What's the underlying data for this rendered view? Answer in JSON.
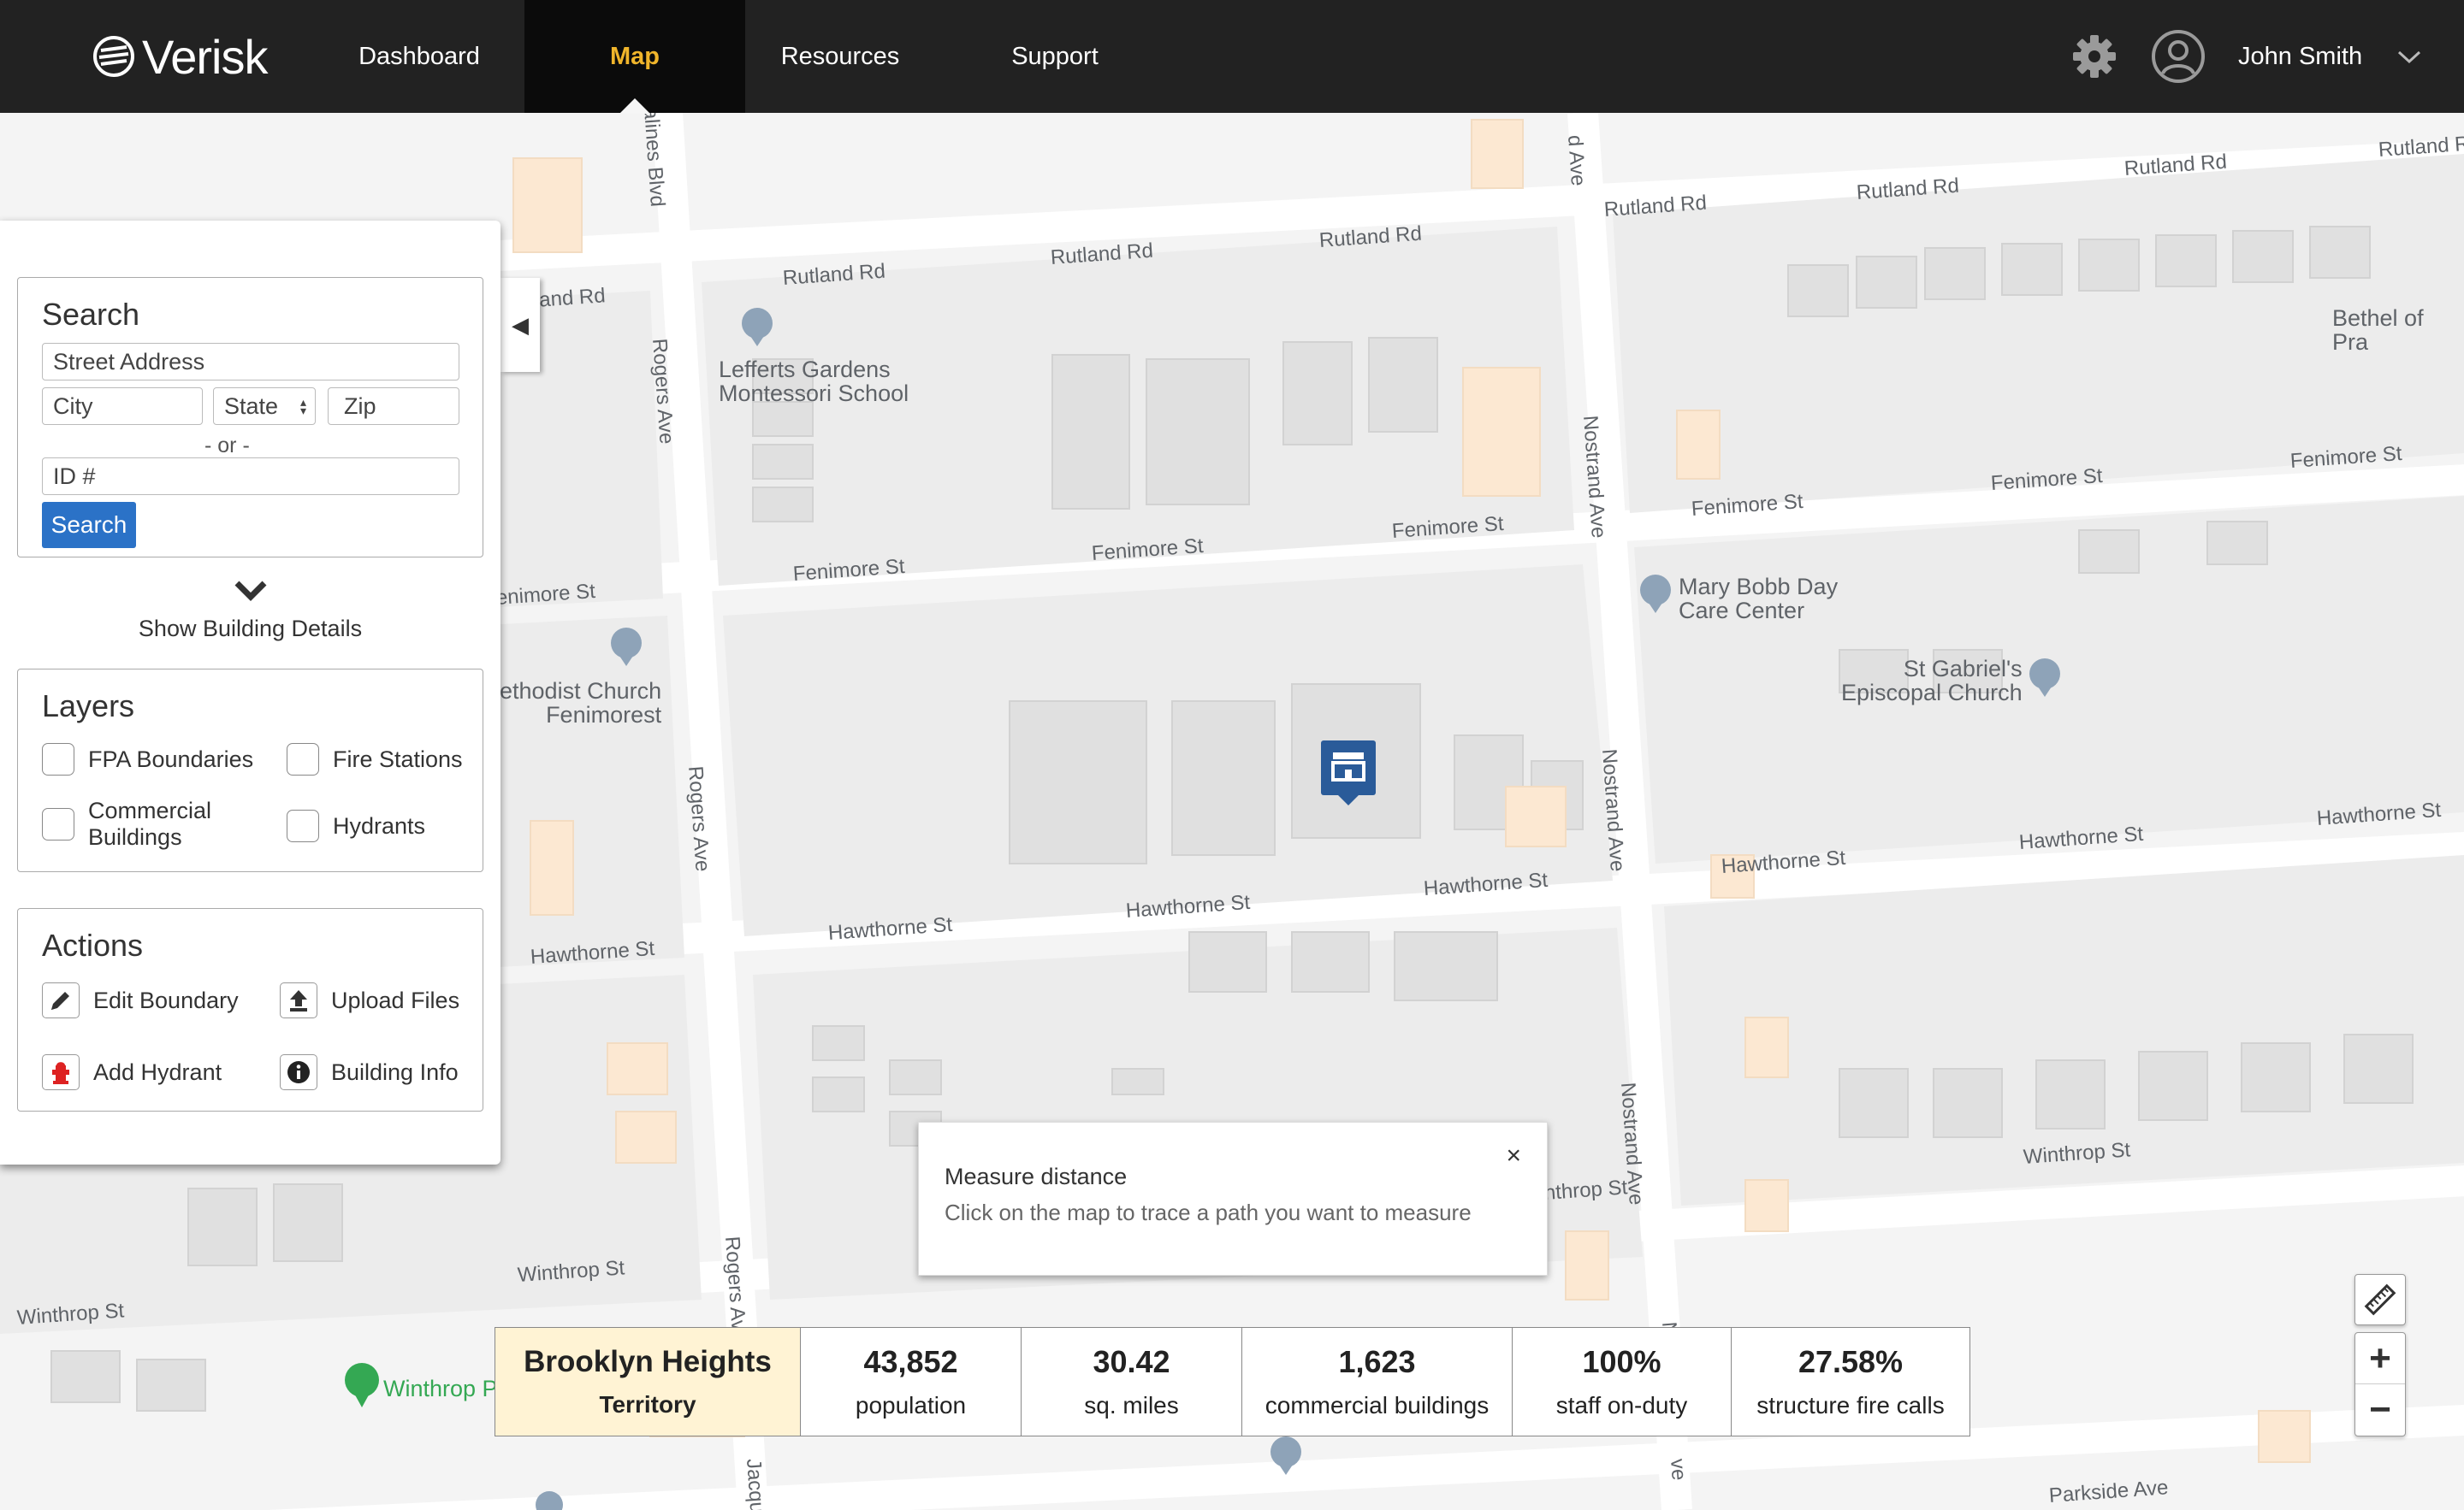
{
  "brand": {
    "name": "Verisk"
  },
  "nav": {
    "items": [
      {
        "label": "Dashboard",
        "active": false
      },
      {
        "label": "Map",
        "active": true
      },
      {
        "label": "Resources",
        "active": false
      },
      {
        "label": "Support",
        "active": false
      }
    ],
    "user_name": "John Smith",
    "settings_icon": "gear-icon",
    "avatar_icon": "user-circle-icon",
    "dropdown_icon": "chevron-down-icon"
  },
  "colors": {
    "nav_bg": "#222222",
    "nav_active": "#f0b52b",
    "primary": "#2b72c7",
    "territory_highlight": "#fff3d4"
  },
  "search": {
    "title": "Search",
    "street_placeholder": "Street Address",
    "city_placeholder": "City",
    "state_placeholder": "State",
    "zip_placeholder": "Zip",
    "or_text": "- or -",
    "id_placeholder": "ID #",
    "button_label": "Search"
  },
  "building_details": {
    "label": "Show Building Details"
  },
  "layers": {
    "title": "Layers",
    "items": [
      {
        "label": "FPA Boundaries",
        "checked": false
      },
      {
        "label": "Fire Stations",
        "checked": false
      },
      {
        "label": "Commercial Buildings",
        "checked": false
      },
      {
        "label": "Hydrants",
        "checked": false
      }
    ]
  },
  "actions": {
    "title": "Actions",
    "items": [
      {
        "label": "Edit Boundary",
        "icon": "pencil-icon"
      },
      {
        "label": "Upload Files",
        "icon": "upload-icon"
      },
      {
        "label": "Add Hydrant",
        "icon": "hydrant-icon"
      },
      {
        "label": "Building Info",
        "icon": "info-icon"
      }
    ]
  },
  "tooltip": {
    "title": "Measure distance",
    "body": "Click on the map to trace a path you want to measure",
    "close": "×"
  },
  "stats": {
    "territory_name": "Brooklyn Heights",
    "territory_label": "Territory",
    "items": [
      {
        "value": "43,852",
        "label": "population"
      },
      {
        "value": "30.42",
        "label": "sq. miles"
      },
      {
        "value": "1,623",
        "label": "commercial buildings"
      },
      {
        "value": "100%",
        "label": "staff on-duty"
      },
      {
        "value": "27.58%",
        "label": "structure fire calls"
      }
    ]
  },
  "map": {
    "streets": {
      "rutland": "Rutland Rd",
      "rutland_partial": "land Rd",
      "fenimore": "Fenimore St",
      "fenimore_partial": "enimore St",
      "hawthorne": "Hawthorne St",
      "winthrop": "Winthrop St",
      "winthrop_partial": "nthrop St",
      "rogers": "Rogers Ave",
      "nostrand": "Nostrand Ave",
      "nostrand_top": "d Ave",
      "nostrand_bottom": "N",
      "rogers_partial": "ve",
      "alines": "alines Blvd",
      "parkside": "Parkside Ave",
      "jacque": "Jacque"
    },
    "pois": {
      "school_line1": "Lefferts Gardens",
      "school_line2": "Montessori School",
      "daycare_line1": "Mary Bobb Day",
      "daycare_line2": "Care Center",
      "church1_line1": "St Gabriel's",
      "church1_line2": "Episcopal Church",
      "church2_line1": "ethodist Church",
      "church2_line2": "Fenimorest",
      "bethel": "Bethel of Pra",
      "winthrop_park": "Winthrop P"
    },
    "tools": {
      "measure": "ruler-icon",
      "zoom_in": "+",
      "zoom_out": "−"
    }
  }
}
